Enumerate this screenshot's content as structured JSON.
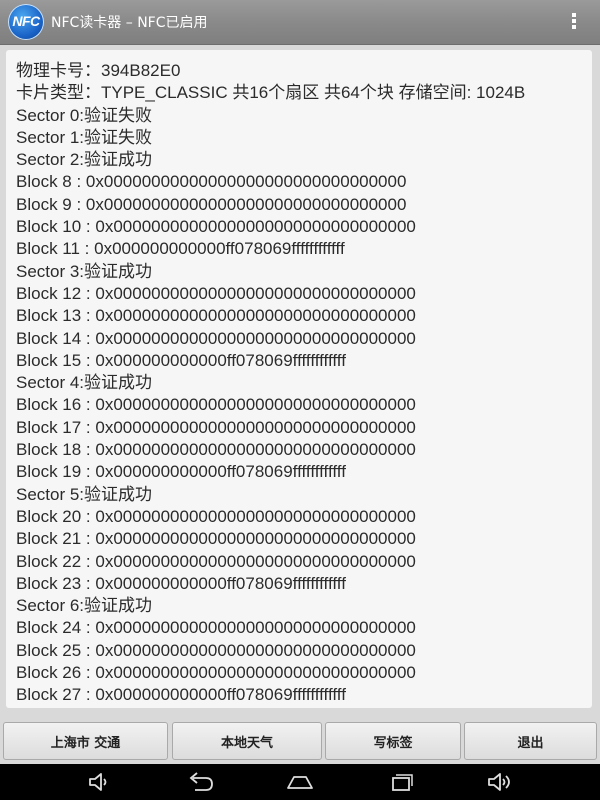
{
  "header": {
    "app_icon_text": "NFC",
    "title": "NFC读卡器 – NFC已启用",
    "menu_icon": "overflow-menu-icon"
  },
  "card_lines": [
    "物理卡号：394B82E0",
    "卡片类型：TYPE_CLASSIC  共16个扇区 共64个块 存储空间: 1024B",
    "Sector 0:验证失败",
    "Sector 1:验证失败",
    "Sector 2:验证成功",
    "Block 8 : 0x00000000000000000000000000000000",
    "Block 9 : 0x00000000000000000000000000000000",
    "Block 10 : 0x00000000000000000000000000000000",
    "Block 11 : 0x000000000000ff078069ffffffffffff",
    "Sector 3:验证成功",
    "Block 12 : 0x00000000000000000000000000000000",
    "Block 13 : 0x00000000000000000000000000000000",
    "Block 14 : 0x00000000000000000000000000000000",
    "Block 15 : 0x000000000000ff078069ffffffffffff",
    "Sector 4:验证成功",
    "Block 16 : 0x00000000000000000000000000000000",
    "Block 17 : 0x00000000000000000000000000000000",
    "Block 18 : 0x00000000000000000000000000000000",
    "Block 19 : 0x000000000000ff078069ffffffffffff",
    "Sector 5:验证成功",
    "Block 20 : 0x00000000000000000000000000000000",
    "Block 21 : 0x00000000000000000000000000000000",
    "Block 22 : 0x00000000000000000000000000000000",
    "Block 23 : 0x000000000000ff078069ffffffffffff",
    "Sector 6:验证成功",
    "Block 24 : 0x00000000000000000000000000000000",
    "Block 25 : 0x00000000000000000000000000000000",
    "Block 26 : 0x00000000000000000000000000000000",
    "Block 27 : 0x000000000000ff078069ffffffffffff"
  ],
  "buttons": {
    "shanghai_traffic": "上海市 交通",
    "local_weather": "本地天气",
    "write_tag": "写标签",
    "exit": "退出"
  },
  "navbar": {
    "icons": [
      "volume-down-icon",
      "back-icon",
      "home-icon",
      "recent-apps-icon",
      "volume-up-icon"
    ]
  },
  "colors": {
    "action_bar": "#8a8a8a",
    "content_background": "#f6f6f6",
    "text": "#2b2b2b",
    "nav_bar": "#000000"
  }
}
